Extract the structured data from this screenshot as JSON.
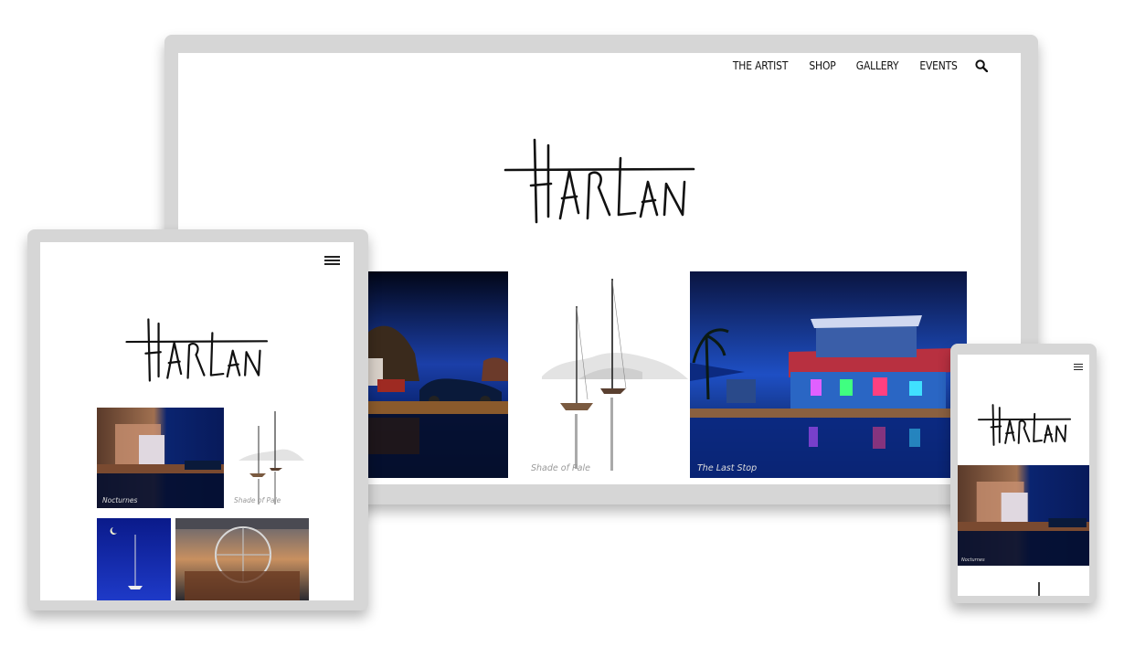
{
  "desktop": {
    "nav": [
      "THE ARTIST",
      "SHOP",
      "GALLERY",
      "EVENTS"
    ],
    "search_icon": "search-icon",
    "tiles": [
      {
        "caption": ""
      },
      {
        "caption": "Shade of Pale"
      },
      {
        "caption": "The Last Stop"
      }
    ]
  },
  "tablet": {
    "menu_icon": "hamburger-menu-icon",
    "tiles": [
      {
        "caption": "Nocturnes"
      },
      {
        "caption": "Shade of Pale"
      },
      {
        "caption": ""
      },
      {
        "caption": ""
      }
    ]
  },
  "phone": {
    "menu_icon": "hamburger-menu-icon",
    "tiles": [
      {
        "caption": "Nocturnes"
      }
    ]
  },
  "brand": {
    "logo_text": "HARLAN",
    "colors": {
      "frame": "#d6d6d6",
      "night_blue": "#0b1f6b",
      "ink": "#111111"
    }
  }
}
